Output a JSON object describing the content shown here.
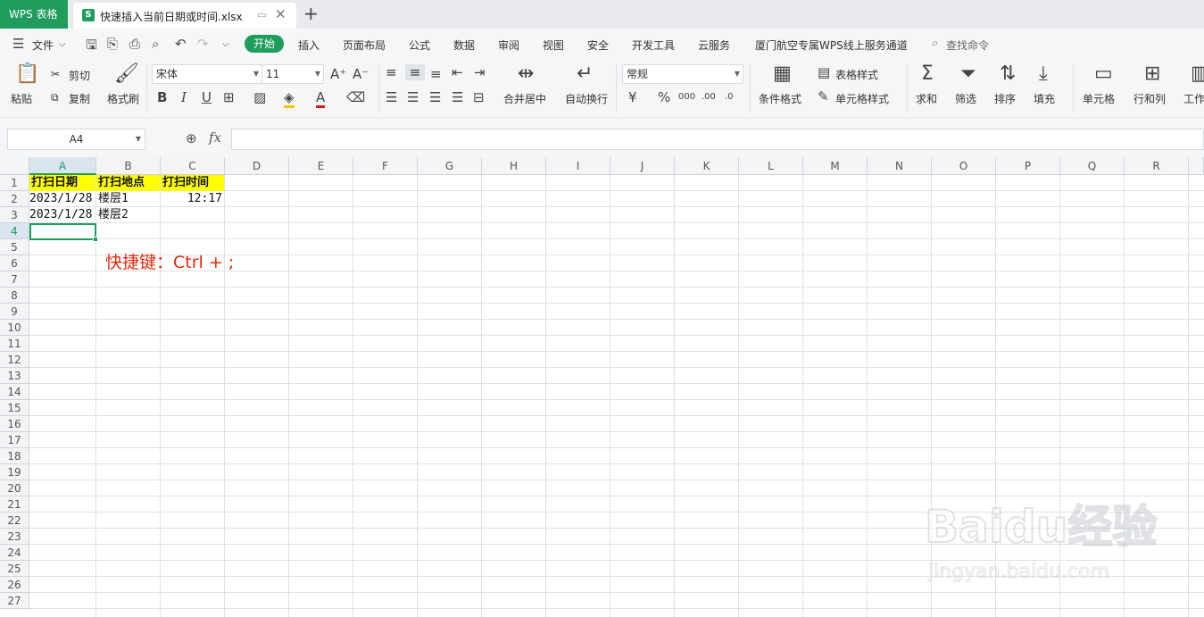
{
  "titlebar": {
    "app_label": "WPS 表格",
    "doc_icon": "S",
    "doc_name": "快速插入当前日期或时间.xlsx"
  },
  "menu": {
    "file_label": "文件",
    "tabs": [
      "开始",
      "插入",
      "页面布局",
      "公式",
      "数据",
      "审阅",
      "视图",
      "安全",
      "开发工具",
      "云服务",
      "厦门航空专属WPS线上服务通道"
    ],
    "search_label": "查找命令"
  },
  "ribbon": {
    "paste": "粘贴",
    "cut": "剪切",
    "copy": "复制",
    "format_painter": "格式刷",
    "font_name": "宋体",
    "font_size": "11",
    "merge_center": "合并居中",
    "wrap_text": "自动换行",
    "number_format": "常规",
    "conditional_format": "条件格式",
    "table_style": "表格样式",
    "cell_style": "单元格样式",
    "sum": "求和",
    "filter": "筛选",
    "sort": "排序",
    "fill": "填充",
    "cell": "单元格",
    "row_col": "行和列",
    "worksheet": "工作"
  },
  "formula_bar": {
    "name_box": "A4",
    "fx_label": "fx",
    "content": ""
  },
  "sheet": {
    "columns": [
      "A",
      "B",
      "C",
      "D",
      "E",
      "F",
      "G",
      "H",
      "I",
      "J",
      "K",
      "L",
      "M",
      "N",
      "O",
      "P",
      "Q",
      "R"
    ],
    "rows": [
      "1",
      "2",
      "3",
      "4",
      "5",
      "6",
      "7",
      "8",
      "9",
      "10",
      "11",
      "12",
      "13",
      "14",
      "15",
      "16",
      "17",
      "18",
      "19",
      "20",
      "21",
      "22",
      "23",
      "24",
      "25",
      "26",
      "27"
    ],
    "headers": [
      "打扫日期",
      "打扫地点",
      "打扫时间"
    ],
    "r2": {
      "a": "2023/1/28",
      "b": "楼层1",
      "c": "12:17"
    },
    "r3": {
      "a": "2023/1/28",
      "b": "楼层2"
    },
    "header_fill": "#ffff00",
    "note": "快捷键：Ctrl + ;",
    "note_color": "#e8290b",
    "accent": "#1e9d5c"
  },
  "watermark": {
    "brand": "Baidu经验",
    "url": "jingyan.baidu.com"
  }
}
